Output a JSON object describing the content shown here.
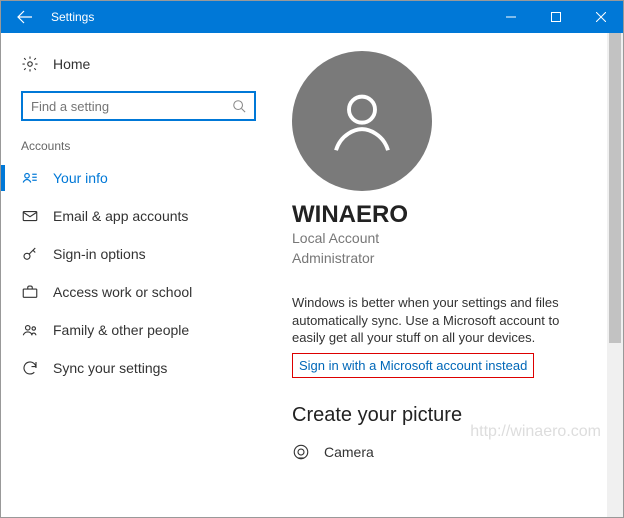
{
  "titlebar": {
    "title": "Settings"
  },
  "sidebar": {
    "home_label": "Home",
    "search_placeholder": "Find a setting",
    "section_label": "Accounts",
    "items": [
      {
        "label": "Your info"
      },
      {
        "label": "Email & app accounts"
      },
      {
        "label": "Sign-in options"
      },
      {
        "label": "Access work or school"
      },
      {
        "label": "Family & other people"
      },
      {
        "label": "Sync your settings"
      }
    ]
  },
  "content": {
    "username": "WINAERO",
    "account_type": "Local Account",
    "role": "Administrator",
    "desc": "Windows is better when your settings and files automatically sync. Use a Microsoft account to easily get all your stuff on all your devices.",
    "signin_link": "Sign in with a Microsoft account instead",
    "picture_heading": "Create your picture",
    "camera_label": "Camera"
  },
  "watermark": "http://winaero.com"
}
